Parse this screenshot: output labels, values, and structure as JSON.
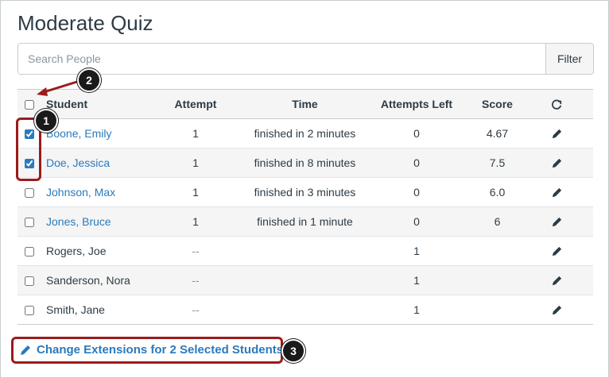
{
  "page": {
    "title": "Moderate Quiz"
  },
  "search": {
    "placeholder": "Search People",
    "value": "",
    "filter_label": "Filter"
  },
  "table": {
    "headers": {
      "student": "Student",
      "attempt": "Attempt",
      "time": "Time",
      "attempts_left": "Attempts Left",
      "score": "Score"
    },
    "rows": [
      {
        "name": "Boone, Emily",
        "linked": true,
        "checked": true,
        "attempt": "1",
        "time": "finished in 2 minutes",
        "attempts_left": "0",
        "score": "4.67"
      },
      {
        "name": "Doe, Jessica",
        "linked": true,
        "checked": true,
        "attempt": "1",
        "time": "finished in 8 minutes",
        "attempts_left": "0",
        "score": "7.5"
      },
      {
        "name": "Johnson, Max",
        "linked": true,
        "checked": false,
        "attempt": "1",
        "time": "finished in 3 minutes",
        "attempts_left": "0",
        "score": "6.0"
      },
      {
        "name": "Jones, Bruce",
        "linked": true,
        "checked": false,
        "attempt": "1",
        "time": "finished in 1 minute",
        "attempts_left": "0",
        "score": "6"
      },
      {
        "name": "Rogers, Joe",
        "linked": false,
        "checked": false,
        "attempt": "--",
        "time": "",
        "attempts_left": "1",
        "score": ""
      },
      {
        "name": "Sanderson, Nora",
        "linked": false,
        "checked": false,
        "attempt": "--",
        "time": "",
        "attempts_left": "1",
        "score": ""
      },
      {
        "name": "Smith, Jane",
        "linked": false,
        "checked": false,
        "attempt": "--",
        "time": "",
        "attempts_left": "1",
        "score": ""
      }
    ]
  },
  "footer": {
    "change_extensions_label": "Change Extensions for 2 Selected Students"
  },
  "callouts": {
    "one": "1",
    "two": "2",
    "three": "3"
  },
  "icons": {
    "refresh": "refresh-icon",
    "edit": "pencil-icon"
  },
  "colors": {
    "link": "#2a7abc",
    "highlight": "#9b1b1b",
    "text": "#2d3b45"
  }
}
